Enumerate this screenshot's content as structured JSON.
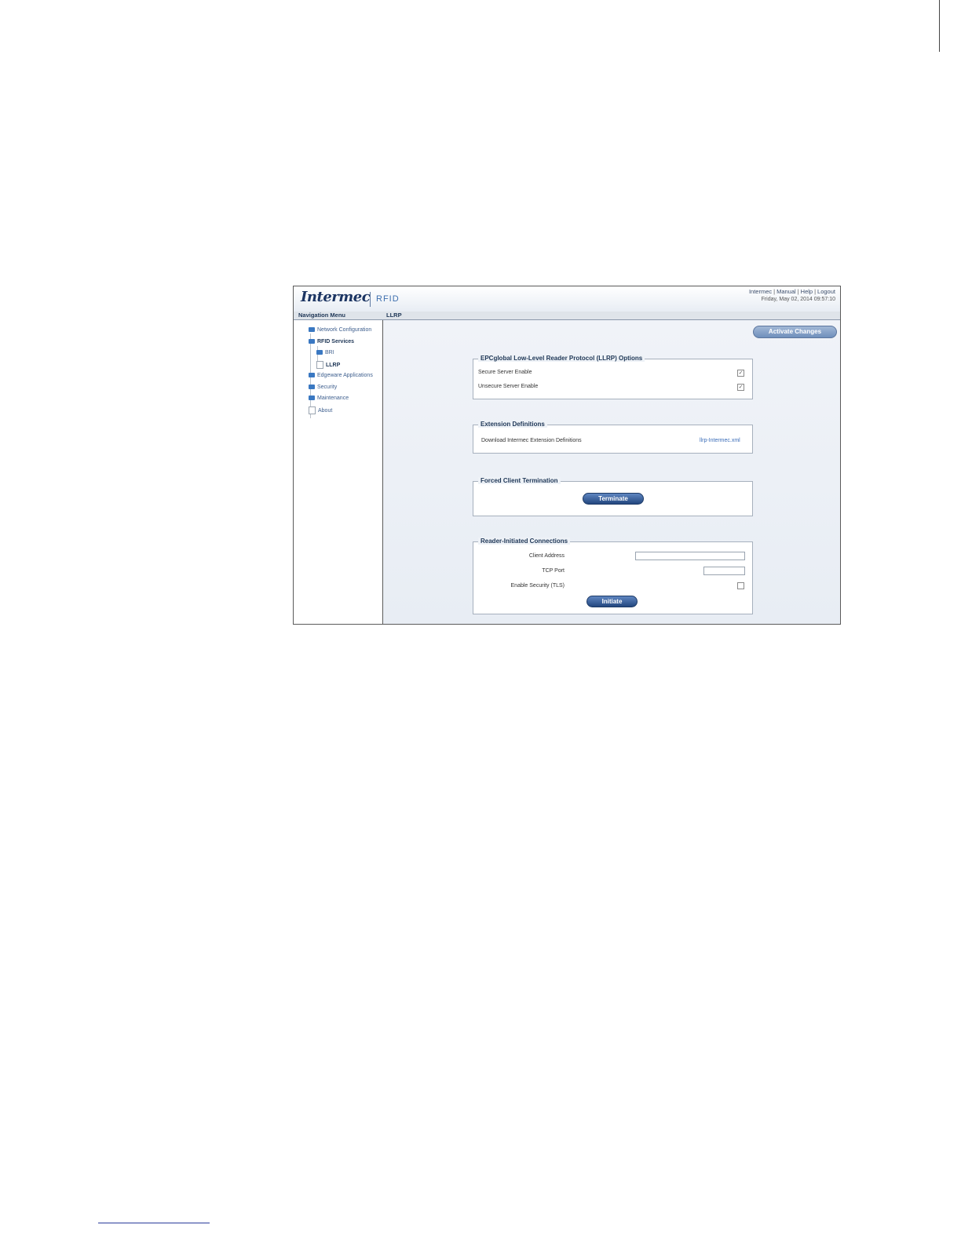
{
  "header": {
    "logo_text": "Intermec",
    "logo_sub": "RFID",
    "links": [
      "Intermec",
      "Manual",
      "Help",
      "Logout"
    ],
    "datetime": "Friday, May 02, 2014 09:57:10"
  },
  "titlebar": {
    "nav_title": "Navigation Menu",
    "page_title": "LLRP"
  },
  "sidebar": {
    "items": [
      {
        "label": "Network Configuration"
      },
      {
        "label": "RFID Services"
      },
      {
        "label": "BRI"
      },
      {
        "label": "LLRP"
      },
      {
        "label": "Edgeware Applications"
      },
      {
        "label": "Security"
      },
      {
        "label": "Maintenance"
      },
      {
        "label": "About"
      }
    ]
  },
  "main": {
    "activate_label": "Activate Changes",
    "llrp_options": {
      "legend": "EPCglobal Low-Level Reader Protocol (LLRP) Options",
      "secure_label": "Secure Server Enable",
      "secure_checked": true,
      "unsecure_label": "Unsecure Server Enable",
      "unsecure_checked": true,
      "check_mark": "✓"
    },
    "extensions": {
      "legend": "Extension Definitions",
      "download_label": "Download Intermec Extension Definitions",
      "download_link": "llrp-Intermec.xml"
    },
    "forced": {
      "legend": "Forced Client Termination",
      "button": "Terminate"
    },
    "reader_initiated": {
      "legend": "Reader-Initiated Connections",
      "client_address_label": "Client Address",
      "client_address_value": "",
      "tcp_port_label": "TCP Port",
      "tcp_port_value": "",
      "tls_label": "Enable Security (TLS)",
      "tls_checked": false,
      "button": "Initiate"
    }
  }
}
